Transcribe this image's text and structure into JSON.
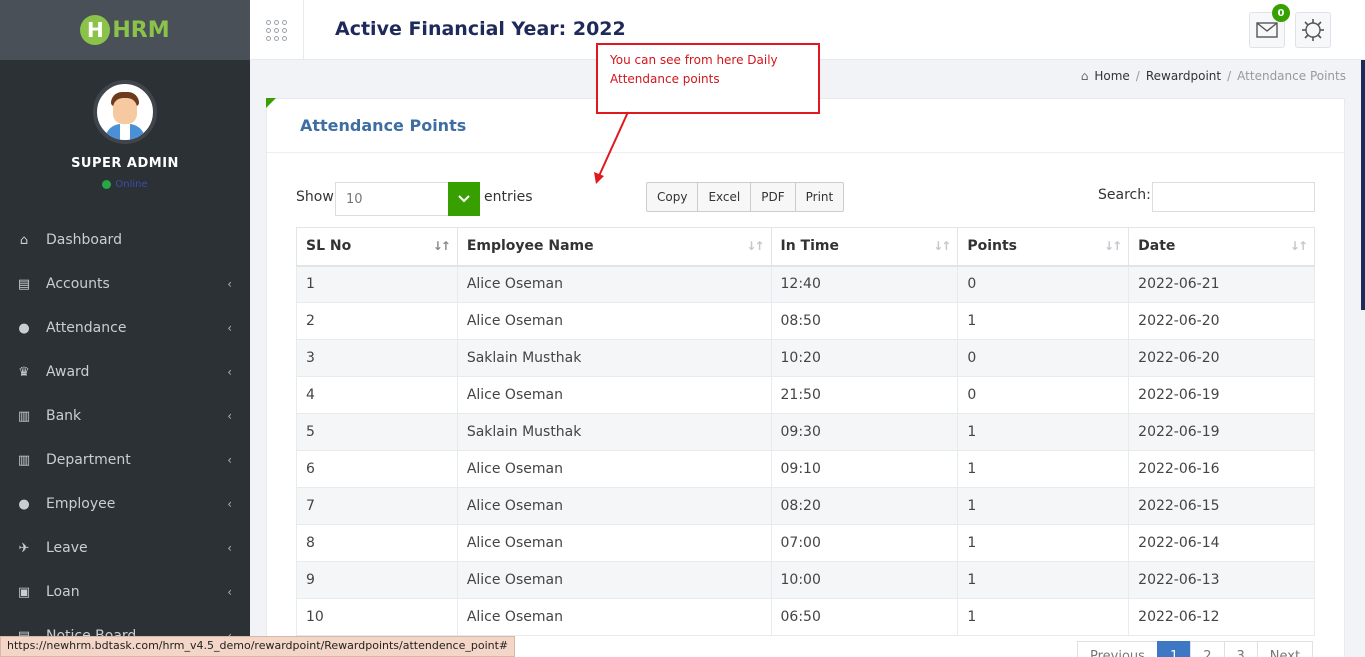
{
  "brand": {
    "logo_h": "H",
    "logo_text": "HRM"
  },
  "profile": {
    "name": "SUPER ADMIN",
    "status": "Online"
  },
  "sidebar": {
    "items": [
      {
        "label": "Dashboard",
        "icon": "dashboard-icon",
        "glyph": "⌂",
        "has_submenu": false
      },
      {
        "label": "Accounts",
        "icon": "accounts-icon",
        "glyph": "▤",
        "has_submenu": true
      },
      {
        "label": "Attendance",
        "icon": "user-icon",
        "glyph": "●",
        "has_submenu": true
      },
      {
        "label": "Award",
        "icon": "trophy-icon",
        "glyph": "♛",
        "has_submenu": true
      },
      {
        "label": "Bank",
        "icon": "bank-icon",
        "glyph": "▥",
        "has_submenu": true
      },
      {
        "label": "Department",
        "icon": "building-icon",
        "glyph": "▥",
        "has_submenu": true
      },
      {
        "label": "Employee",
        "icon": "users-icon",
        "glyph": "●",
        "has_submenu": true
      },
      {
        "label": "Leave",
        "icon": "plane-icon",
        "glyph": "✈",
        "has_submenu": true
      },
      {
        "label": "Loan",
        "icon": "money-icon",
        "glyph": "▣",
        "has_submenu": true
      },
      {
        "label": "Notice Board",
        "icon": "notice-icon",
        "glyph": "▤",
        "has_submenu": true
      }
    ],
    "chevron": "‹"
  },
  "header": {
    "title": "Active Financial Year: 2022",
    "mail_badge": "0"
  },
  "breadcrumb": {
    "home": "Home",
    "middle": "Rewardpoint",
    "current": "Attendance Points",
    "sep": "/"
  },
  "annotation": {
    "text": "You can see from here Daily Attendance points"
  },
  "card": {
    "title": "Attendance Points"
  },
  "controls": {
    "show_label": "Show",
    "entries_value": "10",
    "entries_label": "entries",
    "export_buttons": [
      "Copy",
      "Excel",
      "PDF",
      "Print"
    ],
    "search_label": "Search:",
    "search_value": ""
  },
  "table": {
    "columns": [
      "SL No",
      "Employee Name",
      "In Time",
      "Points",
      "Date"
    ],
    "rows": [
      [
        "1",
        "Alice Oseman",
        "12:40",
        "0",
        "2022-06-21"
      ],
      [
        "2",
        "Alice Oseman",
        "08:50",
        "1",
        "2022-06-20"
      ],
      [
        "3",
        "Saklain Musthak",
        "10:20",
        "0",
        "2022-06-20"
      ],
      [
        "4",
        "Alice Oseman",
        "21:50",
        "0",
        "2022-06-19"
      ],
      [
        "5",
        "Saklain Musthak",
        "09:30",
        "1",
        "2022-06-19"
      ],
      [
        "6",
        "Alice Oseman",
        "09:10",
        "1",
        "2022-06-16"
      ],
      [
        "7",
        "Alice Oseman",
        "08:20",
        "1",
        "2022-06-15"
      ],
      [
        "8",
        "Alice Oseman",
        "07:00",
        "1",
        "2022-06-14"
      ],
      [
        "9",
        "Alice Oseman",
        "10:00",
        "1",
        "2022-06-13"
      ],
      [
        "10",
        "Alice Oseman",
        "06:50",
        "1",
        "2022-06-12"
      ]
    ]
  },
  "pagination": {
    "previous": "Previous",
    "pages": [
      "1",
      "2",
      "3"
    ],
    "next": "Next"
  },
  "status_bar": {
    "url": "https://newhrm.bdtask.com/hrm_v4.5_demo/rewardpoint/Rewardpoints/attendence_point#"
  },
  "colors": {
    "accent_green": "#37a000",
    "sidebar_bg": "#2c3136",
    "title_blue": "#1e2a5a",
    "annotation_red": "#e0191f",
    "pagination_active": "#3e78c4"
  }
}
